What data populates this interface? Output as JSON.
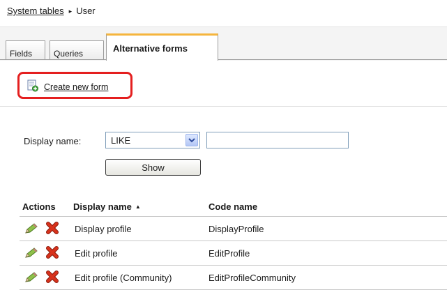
{
  "breadcrumb": {
    "parent_label": "System tables",
    "separator": "▸",
    "current_label": "User"
  },
  "tabs": [
    {
      "label": "Fields",
      "active": false
    },
    {
      "label": "Queries",
      "active": false
    },
    {
      "label": "Alternative forms",
      "active": true
    }
  ],
  "actions": {
    "create_new_form_label": "Create new form",
    "create_new_form_icon": "new-form-icon",
    "highlight_color": "#e41f1f"
  },
  "filter": {
    "label": "Display name:",
    "operator_value": "LIKE",
    "text_value": "",
    "show_button_label": "Show"
  },
  "grid": {
    "headers": {
      "actions": "Actions",
      "display_name": "Display name",
      "code_name": "Code name"
    },
    "sort_indicator": "▲",
    "rows": [
      {
        "display_name": "Display profile",
        "code_name": "DisplayProfile"
      },
      {
        "display_name": "Edit profile",
        "code_name": "EditProfile"
      },
      {
        "display_name": "Edit profile (Community)",
        "code_name": "EditProfileCommunity"
      }
    ]
  },
  "colors": {
    "active_tab_accent": "#f5b53d",
    "delete_icon": "#d8321c",
    "edit_icon": "#8fc14a"
  }
}
